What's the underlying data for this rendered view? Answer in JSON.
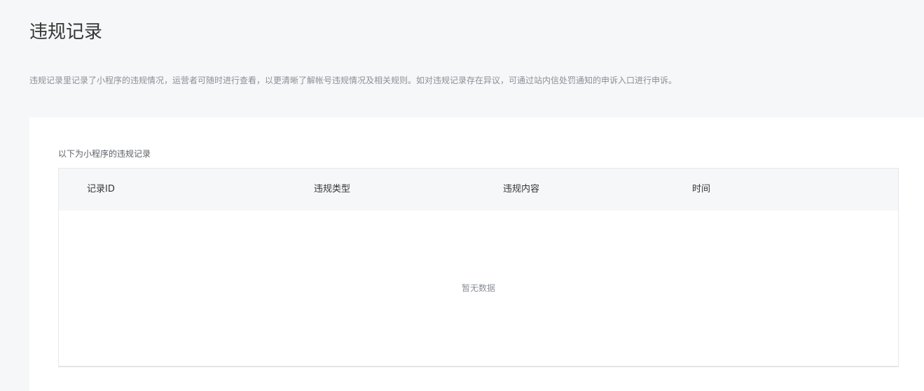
{
  "header": {
    "title": "违规记录",
    "description": "违规记录里记录了小程序的违规情况，运营者可随时进行查看，以更清晰了解帐号违规情况及相关规则。如对违规记录存在异议，可通过站内信处罚通知的申诉入口进行申诉。"
  },
  "records": {
    "subtitle": "以下为小程序的违规记录",
    "columns": [
      "记录ID",
      "违规类型",
      "违规内容",
      "时间"
    ],
    "rows": [],
    "empty_text": "暂无数据"
  }
}
